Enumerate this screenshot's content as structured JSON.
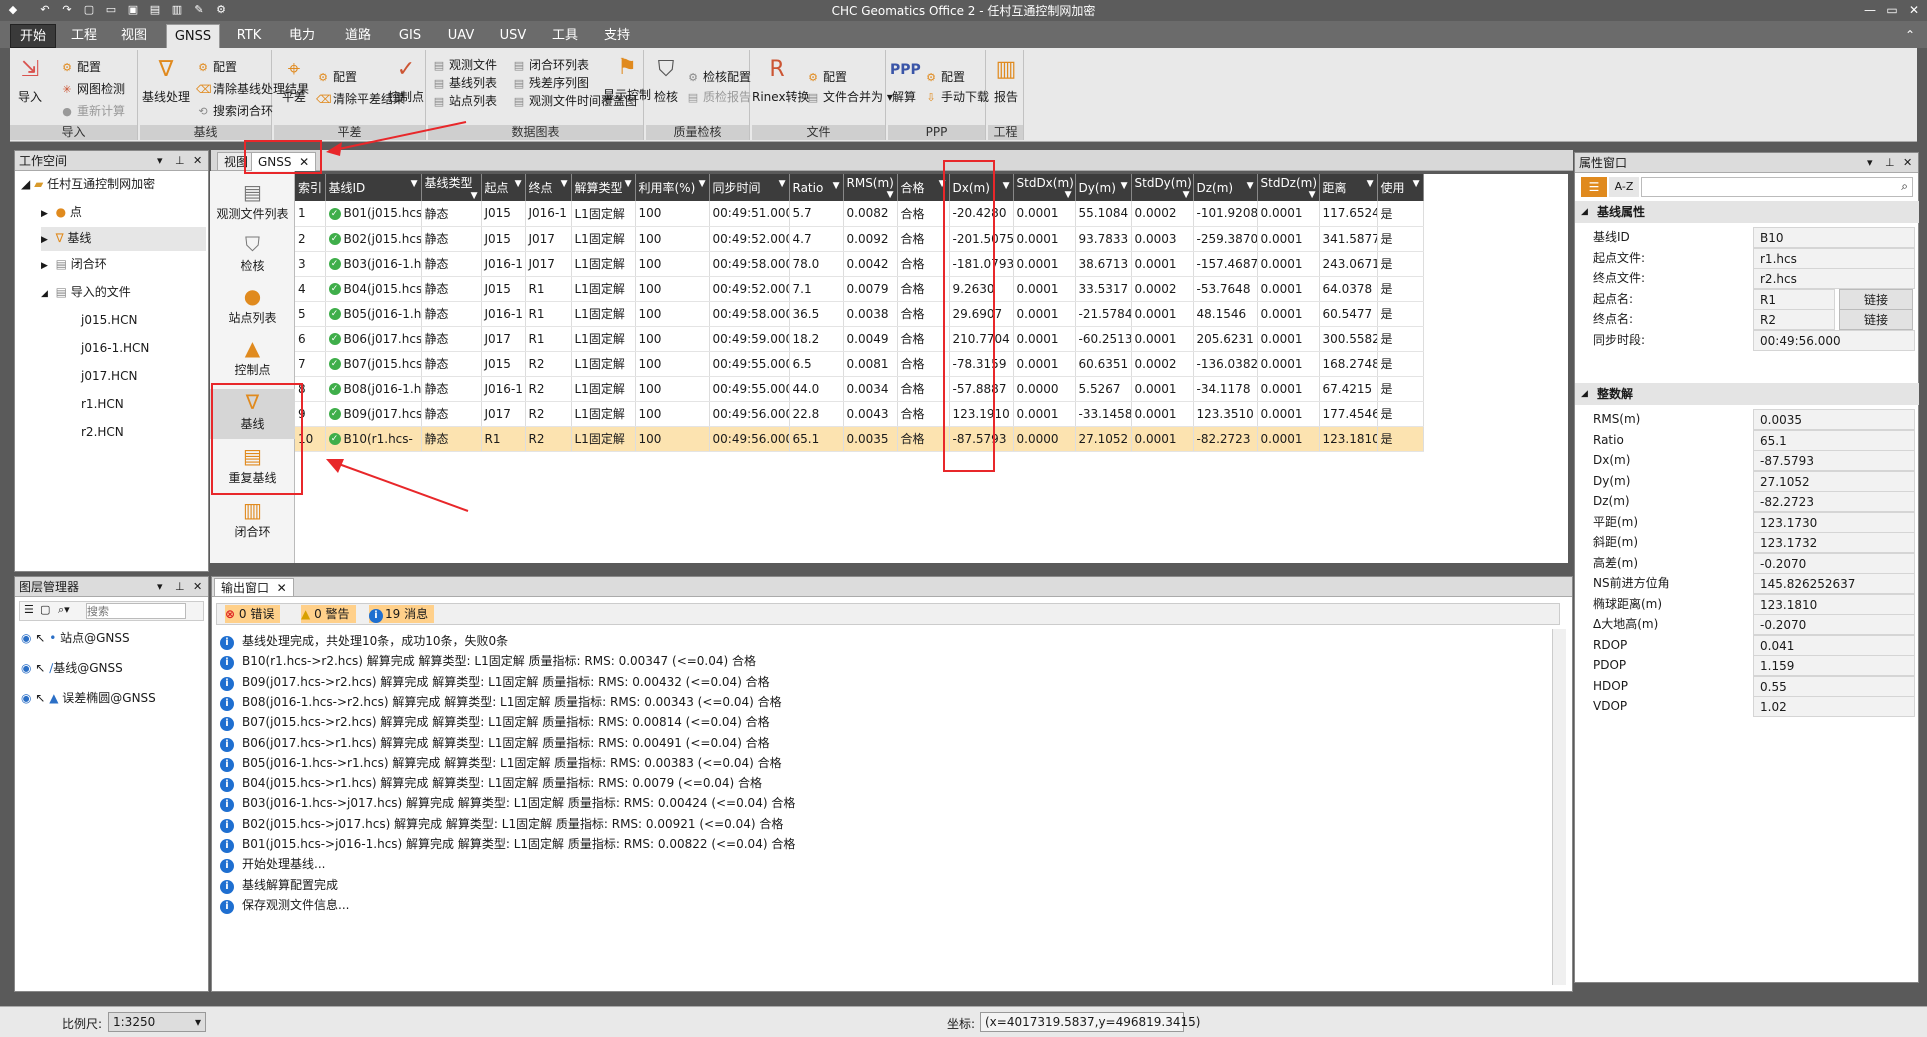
{
  "app": {
    "title": "CHC Geomatics Office 2 - 任村互通控制网加密"
  },
  "ribbon_tabs": [
    "开始",
    "工程",
    "视图",
    "GNSS",
    "RTK",
    "电力",
    "道路",
    "GIS",
    "UAV",
    "USV",
    "工具",
    "支持"
  ],
  "ribbon": {
    "import": {
      "import_label": "导入",
      "config": "配置",
      "net_check": "网图检测",
      "recalc": "重新计算",
      "group": "导入"
    },
    "baseline": {
      "process": "基线处理",
      "config": "配置",
      "clear": "清除基线处理结果",
      "search_loop": "搜索闭合环",
      "group": "基线"
    },
    "adjust": {
      "adjust": "平差",
      "config": "配置",
      "clear": "清除平差结果",
      "control": "控制点",
      "group": "平差"
    },
    "data": {
      "obs_file": "观测文件",
      "baseline_list": "基线列表",
      "station_list": "站点列表",
      "loop_list": "闭合环列表",
      "residual": "残差序列图",
      "timeline": "观测文件时间覆盖图",
      "show_ctrl": "显示控制",
      "group": "数据图表"
    },
    "qc": {
      "check": "检核",
      "check_config": "检核配置",
      "qc_report": "质检报告",
      "group": "质量检核"
    },
    "file": {
      "rinex": "Rinex转换",
      "config": "配置",
      "merge": "文件合并为",
      "group": "文件"
    },
    "ppp": {
      "solve": "解算",
      "config": "配置",
      "manual_dl": "手动下载",
      "group": "PPP"
    },
    "project": {
      "report": "报告",
      "group": "工程"
    }
  },
  "workspace": {
    "title": "工作空间",
    "root": "任村互通控制网加密",
    "items": [
      "点",
      "基线",
      "闭合环",
      "导入的文件"
    ],
    "files": [
      "j015.HCN",
      "j016-1.HCN",
      "j017.HCN",
      "r1.HCN",
      "r2.HCN"
    ]
  },
  "layers": {
    "title": "图层管理器",
    "search_placeholder": "搜索",
    "items": [
      "站点@GNSS",
      "基线@GNSS",
      "误差椭圆@GNSS"
    ]
  },
  "doc_tabs": [
    "视图",
    "GNSS"
  ],
  "left_tools": [
    "观测文件列表",
    "检核",
    "站点列表",
    "控制点",
    "基线",
    "重复基线",
    "闭合环"
  ],
  "grid": {
    "headers": [
      "索引",
      "基线ID",
      "基线类型",
      "起点",
      "终点",
      "解算类型",
      "利用率(%)",
      "同步时间",
      "Ratio",
      "RMS(m)",
      "合格",
      "Dx(m)",
      "StdDx(m)",
      "Dy(m)",
      "StdDy(m)",
      "Dz(m)",
      "StdDz(m)",
      "距离",
      "使用"
    ],
    "rows": [
      [
        "1",
        "B01(j015.hcs",
        "静态",
        "J015",
        "J016-1",
        "L1固定解",
        "100",
        "00:49:51.000",
        "5.7",
        "0.0082",
        "合格",
        "-20.4280",
        "0.0001",
        "55.1084",
        "0.0002",
        "-101.9208",
        "0.0001",
        "117.6524",
        "是"
      ],
      [
        "2",
        "B02(j015.hcs",
        "静态",
        "J015",
        "J017",
        "L1固定解",
        "100",
        "00:49:52.000",
        "4.7",
        "0.0092",
        "合格",
        "-201.5075",
        "0.0001",
        "93.7833",
        "0.0003",
        "-259.3870",
        "0.0001",
        "341.5877",
        "是"
      ],
      [
        "3",
        "B03(j016-1.h",
        "静态",
        "J016-1",
        "J017",
        "L1固定解",
        "100",
        "00:49:58.000",
        "78.0",
        "0.0042",
        "合格",
        "-181.0793",
        "0.0001",
        "38.6713",
        "0.0001",
        "-157.4687",
        "0.0001",
        "243.0671",
        "是"
      ],
      [
        "4",
        "B04(j015.hcs",
        "静态",
        "J015",
        "R1",
        "L1固定解",
        "100",
        "00:49:52.000",
        "7.1",
        "0.0079",
        "合格",
        "9.2630",
        "0.0001",
        "33.5317",
        "0.0002",
        "-53.7648",
        "0.0001",
        "64.0378",
        "是"
      ],
      [
        "5",
        "B05(j016-1.h",
        "静态",
        "J016-1",
        "R1",
        "L1固定解",
        "100",
        "00:49:58.000",
        "36.5",
        "0.0038",
        "合格",
        "29.6907",
        "0.0001",
        "-21.5784",
        "0.0001",
        "48.1546",
        "0.0001",
        "60.5477",
        "是"
      ],
      [
        "6",
        "B06(j017.hcs",
        "静态",
        "J017",
        "R1",
        "L1固定解",
        "100",
        "00:49:59.000",
        "18.2",
        "0.0049",
        "合格",
        "210.7704",
        "0.0001",
        "-60.2513",
        "0.0001",
        "205.6231",
        "0.0001",
        "300.5582",
        "是"
      ],
      [
        "7",
        "B07(j015.hcs",
        "静态",
        "J015",
        "R2",
        "L1固定解",
        "100",
        "00:49:55.000",
        "6.5",
        "0.0081",
        "合格",
        "-78.3159",
        "0.0001",
        "60.6351",
        "0.0002",
        "-136.0382",
        "0.0001",
        "168.2748",
        "是"
      ],
      [
        "8",
        "B08(j016-1.h",
        "静态",
        "J016-1",
        "R2",
        "L1固定解",
        "100",
        "00:49:55.000",
        "44.0",
        "0.0034",
        "合格",
        "-57.8887",
        "0.0000",
        "5.5267",
        "0.0001",
        "-34.1178",
        "0.0001",
        "67.4215",
        "是"
      ],
      [
        "9",
        "B09(j017.hcs",
        "静态",
        "J017",
        "R2",
        "L1固定解",
        "100",
        "00:49:56.000",
        "22.8",
        "0.0043",
        "合格",
        "123.1910",
        "0.0001",
        "-33.1458",
        "0.0001",
        "123.3510",
        "0.0001",
        "177.4546",
        "是"
      ],
      [
        "10",
        "B10(r1.hcs-",
        "静态",
        "R1",
        "R2",
        "L1固定解",
        "100",
        "00:49:56.000",
        "65.1",
        "0.0035",
        "合格",
        "-87.5793",
        "0.0000",
        "27.1052",
        "0.0001",
        "-82.2723",
        "0.0001",
        "123.1810",
        "是"
      ]
    ]
  },
  "output": {
    "title": "输出窗口",
    "errors": "0 错误",
    "warnings": "0 警告",
    "messages": "19 消息",
    "lines": [
      "基线处理完成，共处理10条，成功10条，失败0条",
      "B10(r1.hcs->r2.hcs)  解算完成   解算类型:    L1固定解    质量指标: RMS:  0.00347   (<=0.04)  合格",
      "B09(j017.hcs->r2.hcs)  解算完成   解算类型:    L1固定解    质量指标: RMS:  0.00432   (<=0.04)  合格",
      "B08(j016-1.hcs->r2.hcs)  解算完成   解算类型:    L1固定解    质量指标: RMS:  0.00343   (<=0.04)  合格",
      "B07(j015.hcs->r2.hcs)  解算完成   解算类型:    L1固定解    质量指标: RMS:  0.00814   (<=0.04)  合格",
      "B06(j017.hcs->r1.hcs)  解算完成   解算类型:    L1固定解    质量指标: RMS:  0.00491   (<=0.04)  合格",
      "B05(j016-1.hcs->r1.hcs)  解算完成   解算类型:    L1固定解    质量指标: RMS:  0.00383   (<=0.04)  合格",
      "B04(j015.hcs->r1.hcs)  解算完成   解算类型:    L1固定解    质量指标: RMS:  0.0079   (<=0.04)  合格",
      "B03(j016-1.hcs->j017.hcs)  解算完成   解算类型:    L1固定解    质量指标: RMS:  0.00424   (<=0.04)  合格",
      "B02(j015.hcs->j017.hcs)  解算完成   解算类型:    L1固定解    质量指标: RMS:  0.00921   (<=0.04)  合格",
      "B01(j015.hcs->j016-1.hcs)  解算完成   解算类型:    L1固定解    质量指标: RMS:  0.00822   (<=0.04)  合格",
      "开始处理基线...",
      "基线解算配置完成",
      "保存观测文件信息..."
    ]
  },
  "properties": {
    "title": "属性窗口",
    "sort_az": "A-Z",
    "section1": "基线属性",
    "attrs": [
      {
        "k": "基线ID",
        "v": "B10"
      },
      {
        "k": "起点文件:",
        "v": "r1.hcs"
      },
      {
        "k": "终点文件:",
        "v": "r2.hcs"
      },
      {
        "k": "起点名:",
        "v": "R1",
        "btn": "链接"
      },
      {
        "k": "终点名:",
        "v": "R2",
        "btn": "链接"
      },
      {
        "k": "同步时段:",
        "v": "00:49:56.000"
      }
    ],
    "section2": "整数解",
    "solution": [
      {
        "k": "RMS(m)",
        "v": "0.0035"
      },
      {
        "k": "Ratio",
        "v": "65.1"
      },
      {
        "k": "Dx(m)",
        "v": "-87.5793"
      },
      {
        "k": "Dy(m)",
        "v": "27.1052"
      },
      {
        "k": "Dz(m)",
        "v": "-82.2723"
      },
      {
        "k": "平距(m)",
        "v": "123.1730"
      },
      {
        "k": "斜距(m)",
        "v": "123.1732"
      },
      {
        "k": "高差(m)",
        "v": "-0.2070"
      },
      {
        "k": "NS前进方位角",
        "v": "145.826252637"
      },
      {
        "k": "椭球距离(m)",
        "v": "123.1810"
      },
      {
        "k": "Δ大地高(m)",
        "v": "-0.2070"
      },
      {
        "k": "RDOP",
        "v": "0.041"
      },
      {
        "k": "PDOP",
        "v": "1.159"
      },
      {
        "k": "HDOP",
        "v": "0.55"
      },
      {
        "k": "VDOP",
        "v": "1.02"
      }
    ]
  },
  "status": {
    "scale_label": "比例尺:",
    "scale_value": "1:3250",
    "coord_label": "坐标:",
    "coord_value": "(x=4017319.5837,y=496819.3415)"
  },
  "colors": {
    "accent_red": "#e8272a",
    "selected_row": "#fce3b0",
    "header_dark": "#3c3c3c"
  }
}
